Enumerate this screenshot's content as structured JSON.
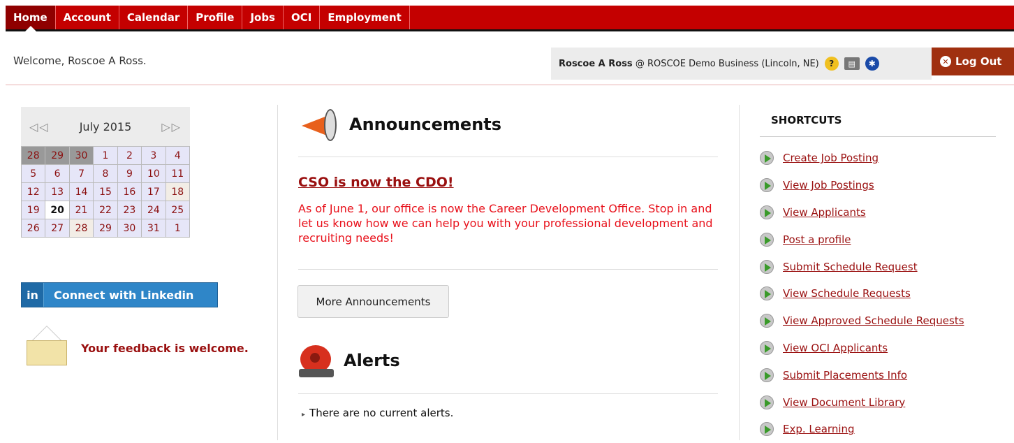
{
  "nav": {
    "tabs": [
      "Home",
      "Account",
      "Calendar",
      "Profile",
      "Jobs",
      "OCI",
      "Employment"
    ]
  },
  "welcome": "Welcome, Roscoe A Ross.",
  "userbar": {
    "name": "Roscoe A Ross",
    "org": "@ ROSCOE Demo Business (Lincoln, NE)",
    "logout_label": "Log Out",
    "icons": [
      "help-icon",
      "print-icon",
      "accessibility-icon",
      "logout-icon"
    ]
  },
  "calendar": {
    "month": "July 2015",
    "rows": [
      [
        "28",
        "29",
        "30",
        "1",
        "2",
        "3",
        "4"
      ],
      [
        "5",
        "6",
        "7",
        "8",
        "9",
        "10",
        "11"
      ],
      [
        "12",
        "13",
        "14",
        "15",
        "16",
        "17",
        "18"
      ],
      [
        "19",
        "20",
        "21",
        "22",
        "23",
        "24",
        "25"
      ],
      [
        "26",
        "27",
        "28",
        "29",
        "30",
        "31",
        "1"
      ]
    ]
  },
  "linkedin": {
    "badge": "in",
    "label": "Connect with Linkedin"
  },
  "feedback": {
    "label": "Your feedback is welcome."
  },
  "announcements": {
    "title": "Announcements",
    "headline": "CSO is now the CDO!",
    "body": "As of June 1, our office is now the Career Development Office.  Stop in and let us know how we can help you with your professional development and recruiting needs!",
    "more_label": "More Announcements"
  },
  "alerts": {
    "title": "Alerts",
    "empty": "There are no current alerts."
  },
  "shortcuts": {
    "title": "SHORTCUTS",
    "items": [
      "Create Job Posting",
      "View Job Postings",
      "View Applicants",
      "Post a profile",
      "Submit Schedule Request",
      "View Schedule Requests",
      "View Approved Schedule Requests",
      "View OCI Applicants",
      "Submit Placements Info",
      "View Document Library",
      "Exp. Learning"
    ]
  },
  "colors": {
    "brand_red": "#c40000",
    "link_red": "#9a1010",
    "announcement_red": "#e8101a"
  }
}
